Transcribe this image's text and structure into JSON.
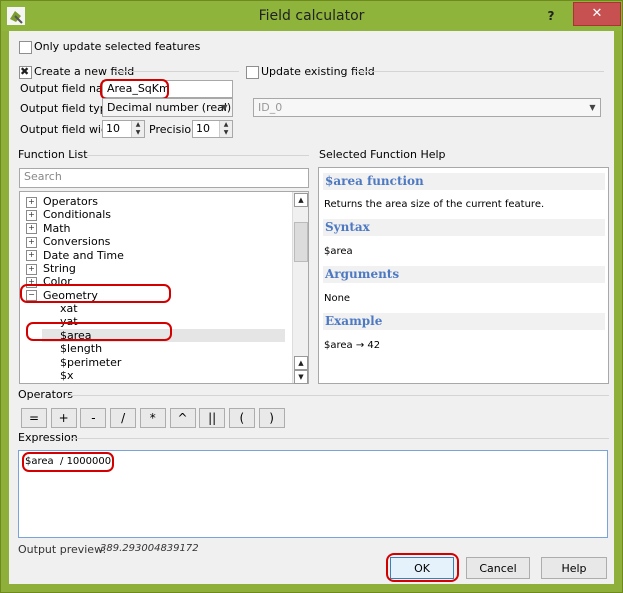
{
  "window": {
    "title": "Field calculator",
    "help_glyph": "?",
    "close_glyph": "✕"
  },
  "options": {
    "only_update_selected": "Only update selected features",
    "create_new_field": "Create a new field",
    "update_existing_field": "Update existing field",
    "output_field_name_label": "Output field name",
    "output_field_name_value": "Area_SqKm",
    "output_field_type_label": "Output field type",
    "output_field_type_value": "Decimal number (real)",
    "output_field_width_label": "Output field width",
    "output_field_width_value": "10",
    "precision_label": "Precision",
    "precision_value": "10",
    "existing_field_value": "ID_0"
  },
  "function_list": {
    "title": "Function List",
    "search_placeholder": "Search",
    "groups": [
      {
        "label": "Operators"
      },
      {
        "label": "Conditionals"
      },
      {
        "label": "Math"
      },
      {
        "label": "Conversions"
      },
      {
        "label": "Date and Time"
      },
      {
        "label": "String"
      },
      {
        "label": "Color"
      },
      {
        "label": "Geometry"
      }
    ],
    "geometry_items": [
      {
        "label": "xat"
      },
      {
        "label": "yat"
      },
      {
        "label": "$area"
      },
      {
        "label": "$length"
      },
      {
        "label": "$perimeter"
      },
      {
        "label": "$x"
      }
    ],
    "expand_glyph": "+",
    "collapse_glyph": "−"
  },
  "help": {
    "title": "Selected Function Help",
    "function_name": "$area function",
    "description": "Returns the area size of the current feature.",
    "syntax_heading": "Syntax",
    "syntax": "$area",
    "arguments_heading": "Arguments",
    "arguments": "None",
    "example_heading": "Example",
    "example": "$area → 42"
  },
  "operators": {
    "title": "Operators",
    "buttons": [
      {
        "label": "="
      },
      {
        "label": "+"
      },
      {
        "label": "-"
      },
      {
        "label": "/"
      },
      {
        "label": "*"
      },
      {
        "label": "^"
      },
      {
        "label": "||"
      },
      {
        "label": "("
      },
      {
        "label": ")"
      }
    ]
  },
  "expression": {
    "title": "Expression",
    "value": "$area  / 1000000"
  },
  "preview": {
    "label": "Output preview:",
    "value": "389.293004839172"
  },
  "buttons": {
    "ok": "OK",
    "cancel": "Cancel",
    "help": "Help"
  },
  "colors": {
    "titlebar": "#8eb43c",
    "highlight": "#d40000",
    "help_heading": "#4d79c2",
    "close": "#c75050"
  }
}
